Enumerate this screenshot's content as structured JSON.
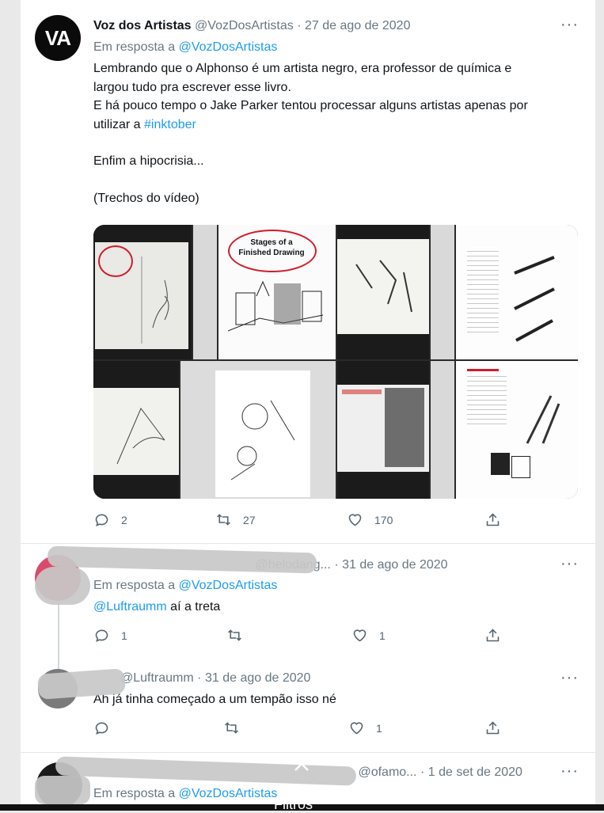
{
  "tweets": [
    {
      "display_name": "Voz dos Artistas",
      "handle": "@VozDosArtistas",
      "date": "27 de ago de 2020",
      "reply_prefix": "Em resposta a",
      "reply_to": "@VozDosArtistas",
      "avatar_initials": "VA",
      "lines": [
        "Lembrando que o Alphonso é um artista negro, era professor de química e",
        "largou tudo pra escrever esse livro.",
        "E há pouco tempo o Jake Parker tentou processar alguns artistas apenas por",
        "utilizar a"
      ],
      "hashtag": "#inktober",
      "line_after": "Enfim a hipocrisia...",
      "line_last": "(Trechos do vídeo)",
      "media_caption": "Stages of a Finished Drawing",
      "replies": "2",
      "retweets": "27",
      "likes": "170"
    },
    {
      "display_name": "",
      "handle": "@helodang...",
      "date": "31 de ago de 2020",
      "reply_prefix": "Em resposta a",
      "reply_to": "@VozDosArtistas",
      "mention": "@Luftraumm",
      "text": "aí a treta",
      "replies": "1",
      "likes": "1"
    },
    {
      "handle": "@Luftraumm",
      "date": "31 de ago de 2020",
      "text": "Ah já tinha começado a um tempão isso né",
      "likes": "1"
    },
    {
      "handle": "@ofamo...",
      "date": "1 de set de 2020",
      "reply_prefix": "Em resposta a",
      "reply_to": "@VozDosArtistas"
    }
  ],
  "more_glyph": "···",
  "separator": "·",
  "overlay_label": "Filtros",
  "colors": {
    "link": "#1d9bf0",
    "muted": "#687782",
    "text": "#0f1419"
  },
  "icons": [
    "reply-icon",
    "retweet-icon",
    "like-icon",
    "share-icon",
    "more-icon",
    "chevron-up-icon"
  ]
}
